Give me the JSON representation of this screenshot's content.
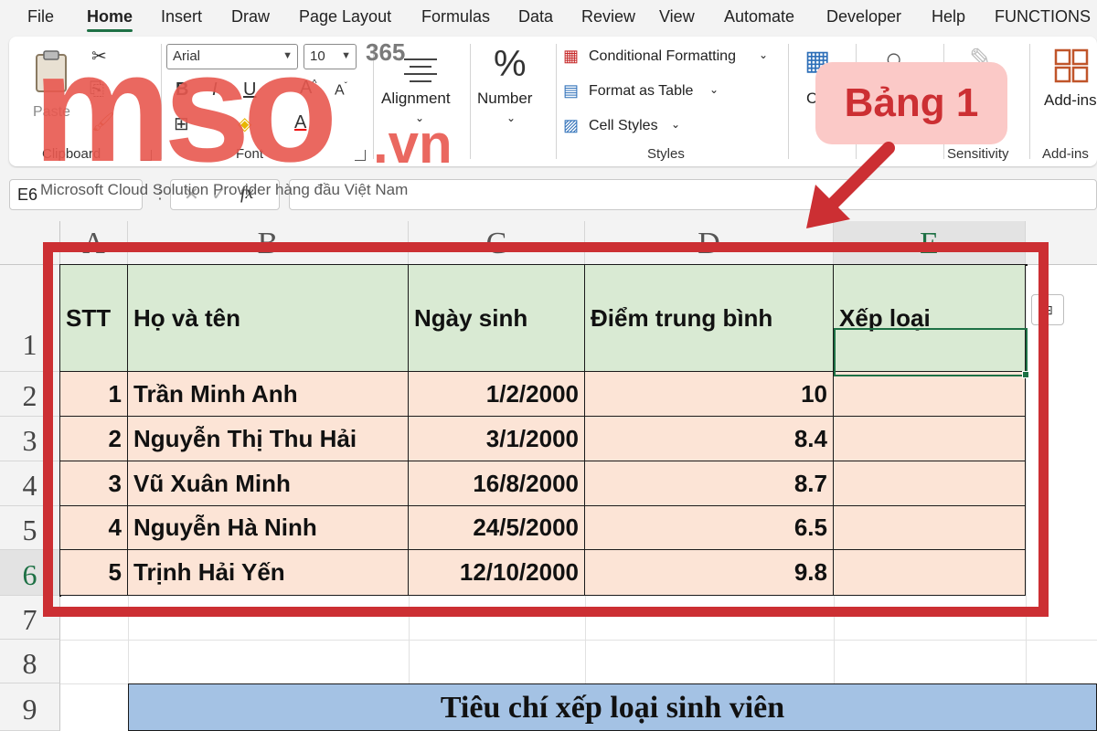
{
  "menu": {
    "tabs": [
      {
        "label": "File"
      },
      {
        "label": "Home"
      },
      {
        "label": "Insert"
      },
      {
        "label": "Draw"
      },
      {
        "label": "Page Layout"
      },
      {
        "label": "Formulas"
      },
      {
        "label": "Data"
      },
      {
        "label": "Review"
      },
      {
        "label": "View"
      },
      {
        "label": "Automate"
      },
      {
        "label": "Developer"
      },
      {
        "label": "Help"
      },
      {
        "label": "FUNCTIONS"
      }
    ],
    "active": "Home"
  },
  "ribbon": {
    "clipboard": {
      "paste_label": "Paste",
      "group": "Clipboard"
    },
    "font": {
      "name": "Arial",
      "size": "10",
      "group": "Font"
    },
    "alignment": {
      "label": "Alignment"
    },
    "number": {
      "label": "Number",
      "symbol": "%"
    },
    "styles": {
      "conditional_formatting": "Conditional Formatting",
      "format_as_table": "Format as Table",
      "cell_styles": "Cell Styles",
      "group": "Styles"
    },
    "cells_partial": "C",
    "sensitivity": {
      "group": "Sensitivity"
    },
    "addins": {
      "label": "Add-ins",
      "group": "Add-ins"
    }
  },
  "formula_bar": {
    "name_box": "E6",
    "fx_symbol": "fx"
  },
  "watermark": {
    "brand": "mso",
    "suffix": ".vn",
    "badge": "365",
    "tagline": "Microsoft Cloud Solution Provider hàng đầu Việt Nam",
    "callout": "Bảng 1"
  },
  "grid": {
    "columns": [
      "A",
      "B",
      "C",
      "D",
      "E"
    ],
    "rows": [
      "1",
      "2",
      "3",
      "4",
      "5",
      "6",
      "7",
      "8",
      "9"
    ],
    "selected_column": "E",
    "selected_row": "6"
  },
  "table": {
    "headers": [
      "STT",
      "Họ và tên",
      "Ngày sinh",
      "Điểm trung bình",
      "Xếp loại"
    ],
    "rows": [
      [
        "1",
        "Trần Minh Anh",
        "1/2/2000",
        "10",
        ""
      ],
      [
        "2",
        "Nguyễn Thị Thu Hải",
        "3/1/2000",
        "8.4",
        ""
      ],
      [
        "3",
        "Vũ Xuân Minh",
        "16/8/2000",
        "8.7",
        ""
      ],
      [
        "4",
        "Nguyễn Hà Ninh",
        "24/5/2000",
        "6.5",
        ""
      ],
      [
        "5",
        "Trịnh Hải Yến",
        "12/10/2000",
        "9.8",
        ""
      ]
    ]
  },
  "criteria_title": "Tiêu chí xếp loại sinh viên",
  "colors": {
    "excel_green": "#1e7145",
    "header_fill": "#d9ead3",
    "body_fill": "#fce4d6",
    "criteria_fill": "#a4c2e4",
    "annotation_red": "#cc2f33",
    "callout_fill": "#fbc9c7"
  }
}
